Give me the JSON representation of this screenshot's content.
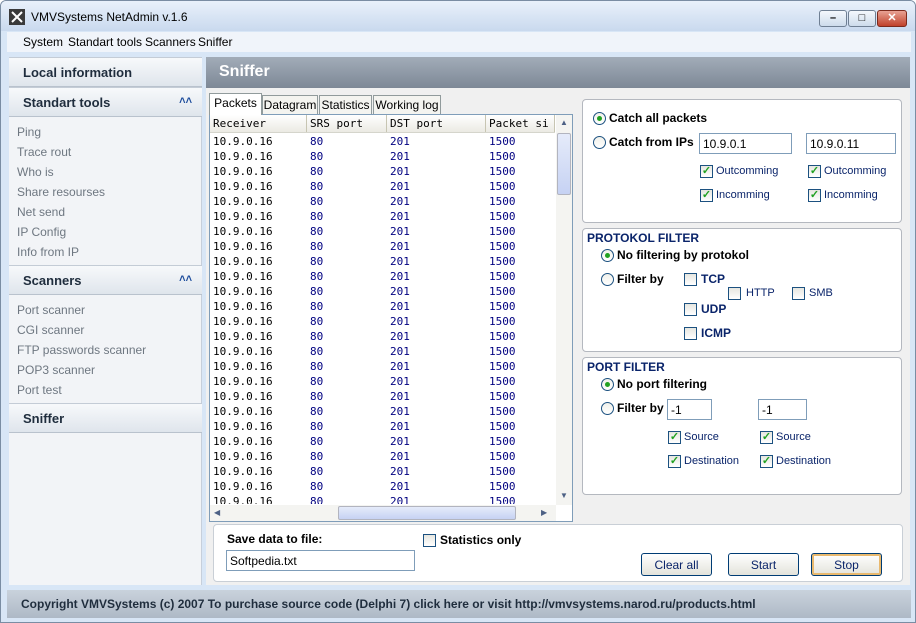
{
  "window": {
    "title": "VMVSystems NetAdmin v.1.6"
  },
  "menu": [
    "System",
    "Standart tools",
    "Scanners",
    "Sniffer"
  ],
  "sidebar": {
    "sections": [
      {
        "title": "Local information",
        "items": []
      },
      {
        "title": "Standart tools",
        "items": [
          "Ping",
          "Trace rout",
          "Who is",
          "Share resourses",
          "Net send",
          "IP Config",
          "Info from IP"
        ]
      },
      {
        "title": "Scanners",
        "items": [
          "Port scanner",
          "CGI scanner",
          "FTP passwords scanner",
          "POP3 scanner",
          "Port test"
        ]
      },
      {
        "title": "Sniffer",
        "items": []
      }
    ]
  },
  "content": {
    "title": "Sniffer"
  },
  "tabs": [
    "Packets",
    "Datagram",
    "Statistics",
    "Working log"
  ],
  "packets": {
    "columns": [
      "Receiver",
      "SRS port",
      "DST port",
      "Packet si"
    ],
    "rows": [
      [
        "10.9.0.16",
        "80",
        "201",
        "1500"
      ],
      [
        "10.9.0.16",
        "80",
        "201",
        "1500"
      ],
      [
        "10.9.0.16",
        "80",
        "201",
        "1500"
      ],
      [
        "10.9.0.16",
        "80",
        "201",
        "1500"
      ],
      [
        "10.9.0.16",
        "80",
        "201",
        "1500"
      ],
      [
        "10.9.0.16",
        "80",
        "201",
        "1500"
      ],
      [
        "10.9.0.16",
        "80",
        "201",
        "1500"
      ],
      [
        "10.9.0.16",
        "80",
        "201",
        "1500"
      ],
      [
        "10.9.0.16",
        "80",
        "201",
        "1500"
      ],
      [
        "10.9.0.16",
        "80",
        "201",
        "1500"
      ],
      [
        "10.9.0.16",
        "80",
        "201",
        "1500"
      ],
      [
        "10.9.0.16",
        "80",
        "201",
        "1500"
      ],
      [
        "10.9.0.16",
        "80",
        "201",
        "1500"
      ],
      [
        "10.9.0.16",
        "80",
        "201",
        "1500"
      ],
      [
        "10.9.0.16",
        "80",
        "201",
        "1500"
      ],
      [
        "10.9.0.16",
        "80",
        "201",
        "1500"
      ],
      [
        "10.9.0.16",
        "80",
        "201",
        "1500"
      ],
      [
        "10.9.0.16",
        "80",
        "201",
        "1500"
      ],
      [
        "10.9.0.16",
        "80",
        "201",
        "1500"
      ],
      [
        "10.9.0.16",
        "80",
        "201",
        "1500"
      ],
      [
        "10.9.0.16",
        "80",
        "201",
        "1500"
      ],
      [
        "10.9.0.16",
        "80",
        "201",
        "1500"
      ],
      [
        "10.9.0.16",
        "80",
        "201",
        "1500"
      ],
      [
        "10.9.0.16",
        "80",
        "201",
        "1500"
      ],
      [
        "10.9.0.16",
        "80",
        "201",
        "1500"
      ]
    ]
  },
  "capture": {
    "catch_all_label": "Catch all packets",
    "catch_from_label": "Catch from IPs",
    "ip1": "10.9.0.1",
    "ip2": "10.9.0.11",
    "outcoming": "Outcomming",
    "incoming": "Incomming"
  },
  "protocol_filter": {
    "title": "PROTOKOL FILTER",
    "no_filter": "No filtering by protokol",
    "filter_by": "Filter by",
    "tcp": "TCP",
    "http": "HTTP",
    "smb": "SMB",
    "udp": "UDP",
    "icmp": "ICMP"
  },
  "port_filter": {
    "title": "PORT FILTER",
    "no_filter": "No port filtering",
    "filter_by": "Filter by",
    "port1": "-1",
    "port2": "-1",
    "source": "Source",
    "destination": "Destination"
  },
  "save": {
    "label": "Save data to file:",
    "filename": "Softpedia.txt",
    "stats_only": "Statistics only"
  },
  "buttons": {
    "clear": "Clear all",
    "start": "Start",
    "stop": "Stop"
  },
  "footer": "Copyright VMVSystems (c) 2007  To purchase source code (Delphi 7) click here or visit http://vmvsystems.narod.ru/products.html",
  "colors": {
    "header_bg": "#8d97a4",
    "group_title": "#0a246a",
    "row_text": "#000080"
  }
}
